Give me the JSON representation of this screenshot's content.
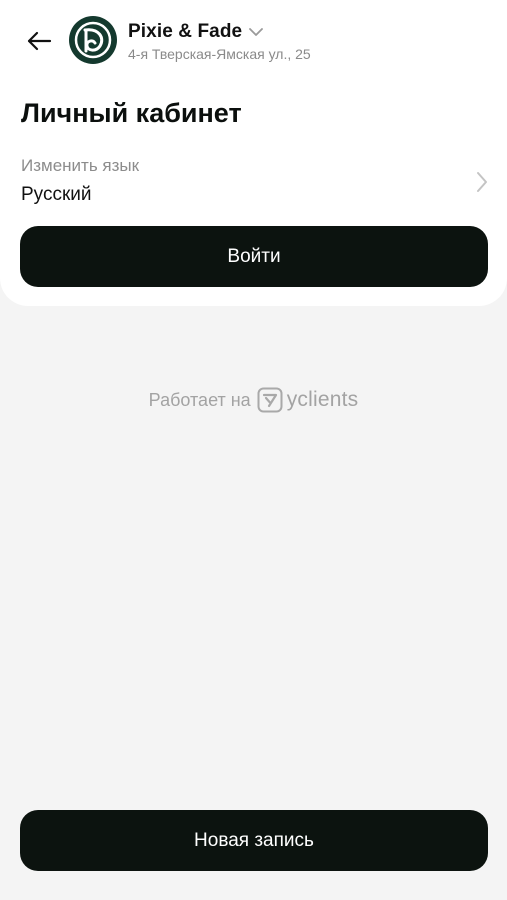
{
  "header": {
    "back_icon": "arrow-left-icon",
    "logo_icon": "pixie-fade-logo",
    "salon_name": "Pixie & Fade",
    "dropdown_icon": "chevron-down-icon",
    "address": "4-я Тверская-Ямская ул., 25"
  },
  "page": {
    "title": "Личный кабинет"
  },
  "language": {
    "label": "Изменить язык",
    "value": "Русский",
    "chevron_icon": "chevron-right-icon"
  },
  "buttons": {
    "login_label": "Войти",
    "new_booking_label": "Новая запись"
  },
  "footer": {
    "powered_by_text": "Работает на",
    "brand_name": "yclients",
    "brand_icon": "yclients-logo-icon"
  },
  "colors": {
    "background": "#f4f4f4",
    "card": "#ffffff",
    "button": "#0c130f",
    "logo_bg": "#14392e",
    "muted_text": "#8c8c8c"
  }
}
